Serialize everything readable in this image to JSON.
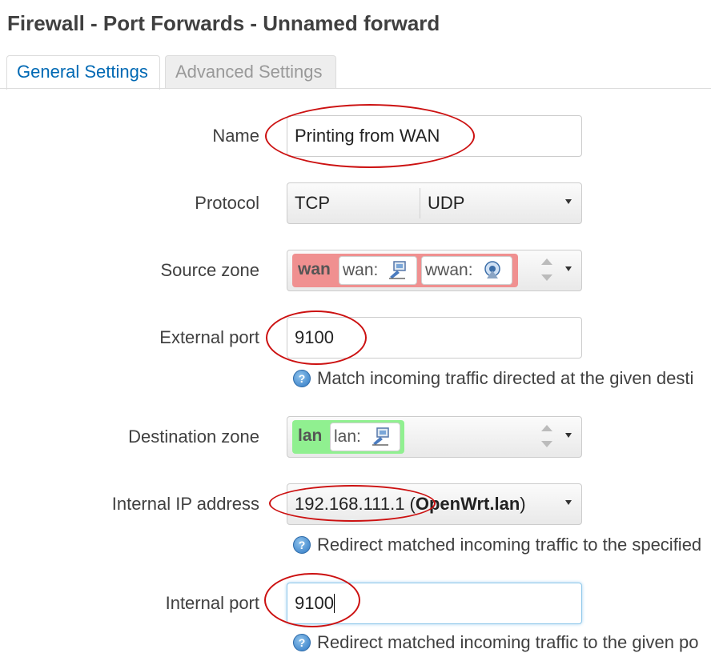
{
  "page_title": "Firewall - Port Forwards - Unnamed forward",
  "tabs": [
    {
      "label": "General Settings",
      "active": true
    },
    {
      "label": "Advanced Settings",
      "active": false
    }
  ],
  "form": {
    "name": {
      "label": "Name",
      "value": "Printing from WAN"
    },
    "protocol": {
      "label": "Protocol",
      "values": [
        "TCP",
        "UDP"
      ]
    },
    "source_zone": {
      "label": "Source zone",
      "zone": "wan",
      "devices": [
        "wan:",
        "wwan:"
      ]
    },
    "external_port": {
      "label": "External port",
      "value": "9100",
      "help": "Match incoming traffic directed at the given desti"
    },
    "destination_zone": {
      "label": "Destination zone",
      "zone": "lan",
      "devices": [
        "lan:"
      ]
    },
    "internal_ip": {
      "label": "Internal IP address",
      "value": "192.168.111.1 (",
      "host": "OpenWrt.lan",
      "suffix": ")",
      "help": "Redirect matched incoming traffic to the specified"
    },
    "internal_port": {
      "label": "Internal port",
      "value": "9100",
      "help": "Redirect matched incoming traffic to the given po"
    }
  },
  "colors": {
    "active_tab": "#0069b4",
    "wan_zone": "#f09090",
    "lan_zone": "#90f090",
    "annotation": "#cc1111"
  },
  "icons": {
    "help": "question-icon",
    "wired": "wired-network-icon",
    "wireless": "wireless-network-icon"
  }
}
